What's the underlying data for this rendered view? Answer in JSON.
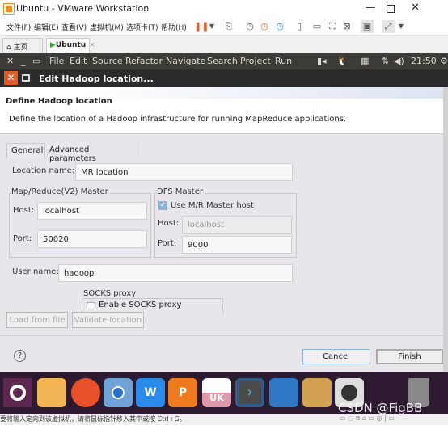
{
  "window": {
    "title": "Ubuntu - VMware Workstation"
  },
  "menu": [
    "文件(F)",
    "编辑(E)",
    "查看(V)",
    "虚拟机(M)",
    "选项卡(T)",
    "帮助(H)"
  ],
  "tabs": [
    {
      "label": "主页"
    },
    {
      "label": "Ubuntu"
    }
  ],
  "ubuntu_bar": {
    "menus": [
      "File",
      "Edit",
      "Source",
      "Refactor",
      "Navigate",
      "Search",
      "Project",
      "Run"
    ],
    "clock": "21:50"
  },
  "dialog": {
    "title": "Edit Hadoop location...",
    "heading": "Define Hadoop location",
    "description": "Define the location of a Hadoop infrastructure for running MapReduce applications.",
    "tabs": [
      "General",
      "Advanced parameters"
    ],
    "location_name_label": "Location name:",
    "location_name": "MR location",
    "mr_master": {
      "title": "Map/Reduce(V2) Master",
      "host_label": "Host:",
      "host": "localhost",
      "port_label": "Port:",
      "port": "50020"
    },
    "dfs_master": {
      "title": "DFS Master",
      "use_mr_host_label": "Use M/R Master host",
      "use_mr_host": true,
      "host_label": "Host:",
      "host": "localhost",
      "port_label": "Port:",
      "port": "9000"
    },
    "user_name_label": "User name:",
    "user_name": "hadoop",
    "socks": {
      "title": "SOCKS proxy",
      "enable_label": "Enable SOCKS proxy"
    },
    "load_from_file": "Load from file",
    "validate_location": "Validate location",
    "help": "?",
    "cancel": "Cancel",
    "finish": "Finish"
  },
  "watermark": "CSDN @FigBB",
  "status": "要将输入定向到该虚拟机，请将鼠标指针移入其中或按 Ctrl+G。"
}
